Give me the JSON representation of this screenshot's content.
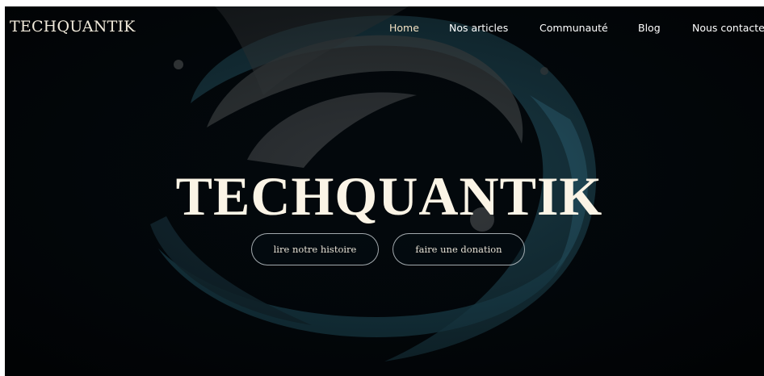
{
  "header": {
    "brand": "TECHQUANTIK",
    "nav": [
      {
        "label": "Home",
        "active": true
      },
      {
        "label": "Nos articles",
        "active": false
      },
      {
        "label": "Communauté",
        "active": false
      },
      {
        "label": "Blog",
        "active": false
      },
      {
        "label": "Nous contacter",
        "active": false
      }
    ]
  },
  "hero": {
    "title": "TECHQUANTIK",
    "buttons": {
      "story": "lire notre histoire",
      "donate": "faire une donation"
    }
  },
  "colors": {
    "background": "#03080c",
    "text": "#fbf4e6",
    "nav_active": "#f3e2c4",
    "swirl_teal": "#1f4a58",
    "swirl_grey": "#4a4e50"
  }
}
